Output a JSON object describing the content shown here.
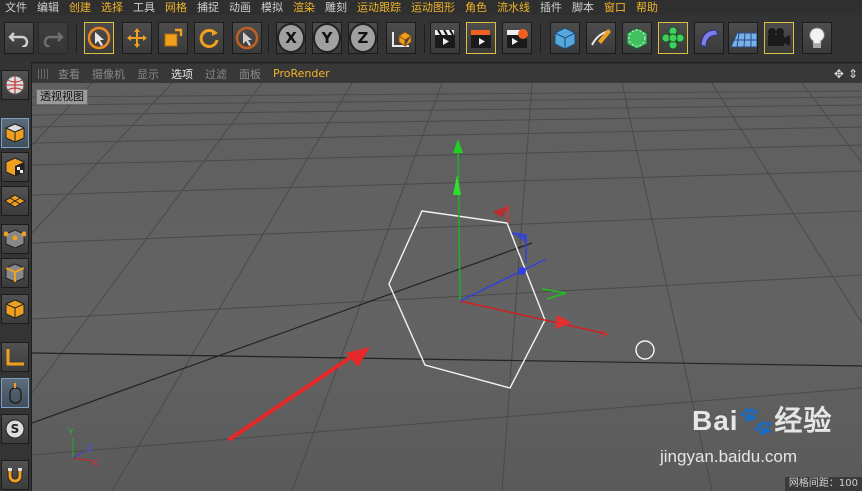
{
  "menu": [
    "文件",
    "编辑",
    "创建",
    "选择",
    "工具",
    "网格",
    "捕捉",
    "动画",
    "模拟",
    "渲染",
    "雕刻",
    "运动跟踪",
    "运动图形",
    "角色",
    "流水线",
    "插件",
    "脚本",
    "窗口",
    "帮助"
  ],
  "menu_accent": [
    "创建",
    "选择",
    "网格",
    "渲染",
    "运动跟踪",
    "运动图形",
    "角色",
    "流水线",
    "窗口",
    "帮助"
  ],
  "toolbar": {
    "undo": "undo-icon",
    "redo": "redo-icon",
    "select": "live-select-icon",
    "move": "move-icon",
    "scale": "scale-icon",
    "rotate": "rotate-icon",
    "recent": "recent-tool-icon",
    "axis_x": "X",
    "axis_y": "Y",
    "axis_z": "Z"
  },
  "viewport_menu": [
    "查看",
    "摄像机",
    "显示",
    "选项",
    "过滤",
    "面板",
    "ProRender"
  ],
  "viewport_active": "选项",
  "viewport_label": "透视视图",
  "grid_info": "网格间距：100",
  "watermark": {
    "main": "Bai🐾经验",
    "sub": "jingyan.baidu.com"
  },
  "axis_gizmo": {
    "x": "X",
    "y": "Y",
    "z": "Z"
  },
  "colors": {
    "accent": "#f0b429",
    "axis_x": "#e03030",
    "axis_y": "#30c030",
    "axis_z": "#3040e0"
  }
}
